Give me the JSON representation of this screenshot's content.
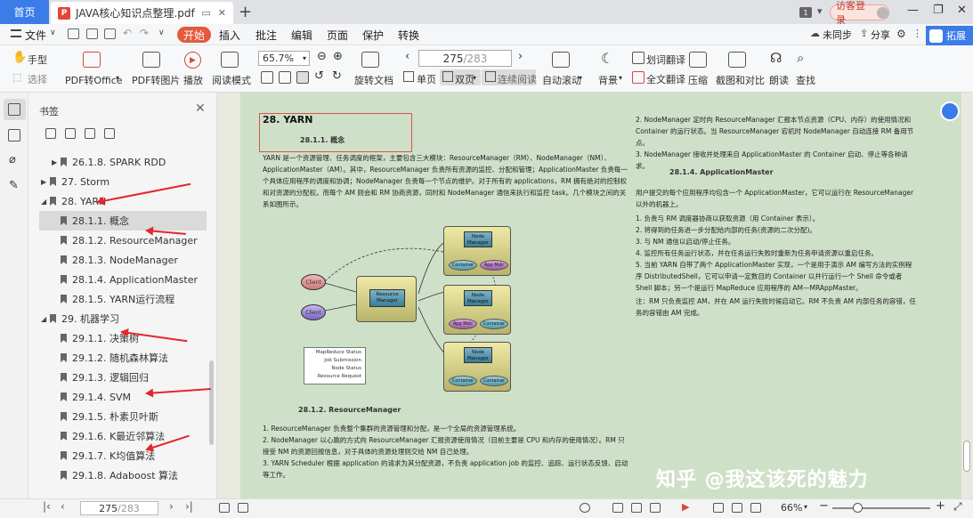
{
  "titlebar": {
    "home_tab": "首页",
    "doc_tab": "JAVA核心知识点整理.pdf",
    "page_badge": "1",
    "login_label": "访客登录"
  },
  "menubar": {
    "file": "文件",
    "items": [
      "开始",
      "插入",
      "批注",
      "编辑",
      "页面",
      "保护",
      "转换"
    ],
    "sync": "未同步",
    "share": "分享",
    "expand": "拓展"
  },
  "toolbar": {
    "hand": "手型",
    "select": "选择",
    "pdf_to_office": "PDF转Office",
    "pdf_to_image": "PDF转图片",
    "play": "播放",
    "read_mode": "阅读模式",
    "zoom": "65.7%",
    "rotate_doc": "旋转文档",
    "page_current": "275",
    "page_total": "/283",
    "single_page": "单页",
    "double_page": "双页",
    "continuous": "连续阅读",
    "auto_scroll": "自动滚动",
    "background": "背景",
    "word_translate": "划词翻译",
    "full_translate": "全文翻译",
    "compress": "压缩",
    "screenshot_compare": "截图和对比",
    "read_aloud": "朗读",
    "find": "查找"
  },
  "bookmark_panel": {
    "title": "书签",
    "items": [
      {
        "label": "26.1.8. SPARK RDD",
        "level": 2,
        "arrow": "▶"
      },
      {
        "label": "27. Storm",
        "level": 1,
        "arrow": "▶"
      },
      {
        "label": "28. YARN",
        "level": 1,
        "arrow": "◢"
      },
      {
        "label": "28.1.1. 概念",
        "level": 2,
        "arrow": ""
      },
      {
        "label": "28.1.2. ResourceManager",
        "level": 2,
        "arrow": ""
      },
      {
        "label": "28.1.3. NodeManager",
        "level": 2,
        "arrow": ""
      },
      {
        "label": "28.1.4. ApplicationMaster",
        "level": 2,
        "arrow": ""
      },
      {
        "label": "28.1.5. YARN运行流程",
        "level": 2,
        "arrow": ""
      },
      {
        "label": "29. 机器学习",
        "level": 1,
        "arrow": "◢"
      },
      {
        "label": "29.1.1. 决策树",
        "level": 2,
        "arrow": ""
      },
      {
        "label": "29.1.2. 随机森林算法",
        "level": 2,
        "arrow": ""
      },
      {
        "label": "29.1.3. 逻辑回归",
        "level": 2,
        "arrow": ""
      },
      {
        "label": "29.1.4. SVM",
        "level": 2,
        "arrow": ""
      },
      {
        "label": "29.1.5. 朴素贝叶斯",
        "level": 2,
        "arrow": ""
      },
      {
        "label": "29.1.6. K最近邻算法",
        "level": 2,
        "arrow": ""
      },
      {
        "label": "29.1.7. K均值算法",
        "level": 2,
        "arrow": ""
      },
      {
        "label": "29.1.8. Adaboost 算法",
        "level": 2,
        "arrow": ""
      }
    ],
    "selected_index": 3
  },
  "document": {
    "section_heading": "28.   YARN",
    "sub_1": "28.1.1.     概念",
    "intro": "YARN 是一个资源管理、任务调度的框架，主要包含三大模块：ResourceManager（RM）、NodeManager（NM）、ApplicationMaster（AM）。其中，ResourceManager 负责所有资源的监控、分配和管理；ApplicationMaster 负责每一个具体应用程序的调度和协调；NodeManager 负责每一个节点的维护。对于所有的 applications，RM 拥有绝对的控制权和对资源的分配权。而每个 AM 则会和 RM 协商资源，同时和 NodeManager 通信来执行和监控 task。几个模块之间的关系如图所示。",
    "diagram": {
      "client": "Client",
      "resource_manager": "Resource Manager",
      "node_manager": "Node Manager",
      "container": "Container",
      "app_mstr": "App Mstr",
      "legend": [
        "MapReduce Status",
        "Job Submission",
        "Node Status",
        "Resource Request"
      ]
    },
    "sub_2": "28.1.2.     ResourceManager",
    "rm_list": [
      "1.   ResourceManager 负责整个集群的资源管理和分配，是一个全局的资源管理系统。",
      "2.   NodeManager 以心跳的方式向 ResourceManager 汇报资源使用情况（目前主要是 CPU 和内存的使用情况）。RM 只接受 NM 的资源回报信息，对于具体的资源处理则交给 NM 自己处理。",
      "3.   YARN Scheduler 根据 application 的请求为其分配资源，不负责 application job 的监控、追踪、运行状态反馈、启动等工作。"
    ],
    "nm_list": [
      "2.   NodeManager 定时向 ResourceManager 汇报本节点资源（CPU、内存）的使用情况和 Container 的运行状态。当 ResourceManager 宕机时 NodeManager 自动连接 RM 备用节点。",
      "3.   NodeManager 接收并处理来自 ApplicationMaster 的 Container 启动、停止等各种请求。"
    ],
    "sub_3": "28.1.4.     ApplicationMaster",
    "am_intro": "用户提交的每个应用程序均包含一个 ApplicationMaster，它可以运行在 ResourceManager 以外的机器上。",
    "am_list": [
      "1.   负责与 RM 调度器协商以获取资源（用 Container 表示）。",
      "2.   将得到的任务进一步分配给内部的任务(资源的二次分配)。",
      "3.   与 NM 通信以启动/停止任务。",
      "4.   监控所有任务运行状态，并在任务运行失败时重新为任务申请资源以重启任务。",
      "5.   当前 YARN 自带了两个 ApplicationMaster 实现，一个是用于演示 AM 编写方法的实例程序 DistributedShell，它可以申请一定数目的 Container 以并行运行一个 Shell 命令或者 Shell 脚本；另一个是运行 MapReduce 应用程序的 AM—MRAppMaster。"
    ],
    "am_note": "注：RM 只负责监控 AM，并在 AM 运行失败时候启动它。RM 不负责 AM 内部任务的容错，任务的容错由 AM 完成。",
    "watermark": "知乎 @我这该死的魅力"
  },
  "statusbar": {
    "page_current": "275",
    "page_total": "/283",
    "zoom": "66%"
  },
  "colors": {
    "accent": "#3b7ce8",
    "start_tab": "#e35a3c",
    "page_bg": "#cfe0c8",
    "annotation_red": "#e3262f"
  }
}
